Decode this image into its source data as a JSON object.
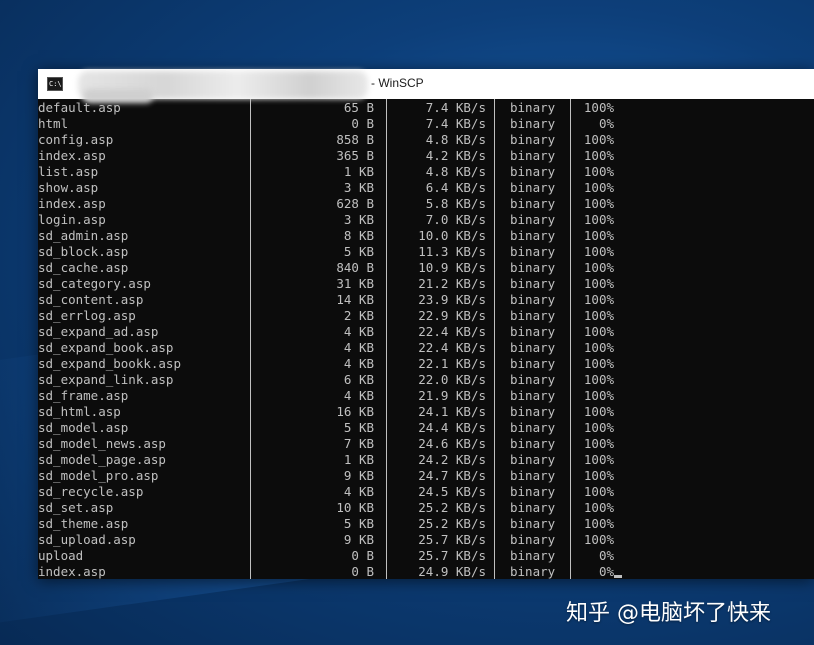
{
  "window": {
    "title": "- WinSCP",
    "icon": "console-icon"
  },
  "transfers": [
    {
      "name": "default.asp",
      "size": "65 B",
      "speed": "7.4 KB/s",
      "mode": "binary",
      "progress": "100%"
    },
    {
      "name": "html",
      "size": "0 B",
      "speed": "7.4 KB/s",
      "mode": "binary",
      "progress": "0%"
    },
    {
      "name": "config.asp",
      "size": "858 B",
      "speed": "4.8 KB/s",
      "mode": "binary",
      "progress": "100%"
    },
    {
      "name": "index.asp",
      "size": "365 B",
      "speed": "4.2 KB/s",
      "mode": "binary",
      "progress": "100%"
    },
    {
      "name": "list.asp",
      "size": "1 KB",
      "speed": "4.8 KB/s",
      "mode": "binary",
      "progress": "100%"
    },
    {
      "name": "show.asp",
      "size": "3 KB",
      "speed": "6.4 KB/s",
      "mode": "binary",
      "progress": "100%"
    },
    {
      "name": "index.asp",
      "size": "628 B",
      "speed": "5.8 KB/s",
      "mode": "binary",
      "progress": "100%"
    },
    {
      "name": "login.asp",
      "size": "3 KB",
      "speed": "7.0 KB/s",
      "mode": "binary",
      "progress": "100%"
    },
    {
      "name": "sd_admin.asp",
      "size": "8 KB",
      "speed": "10.0 KB/s",
      "mode": "binary",
      "progress": "100%"
    },
    {
      "name": "sd_block.asp",
      "size": "5 KB",
      "speed": "11.3 KB/s",
      "mode": "binary",
      "progress": "100%"
    },
    {
      "name": "sd_cache.asp",
      "size": "840 B",
      "speed": "10.9 KB/s",
      "mode": "binary",
      "progress": "100%"
    },
    {
      "name": "sd_category.asp",
      "size": "31 KB",
      "speed": "21.2 KB/s",
      "mode": "binary",
      "progress": "100%"
    },
    {
      "name": "sd_content.asp",
      "size": "14 KB",
      "speed": "23.9 KB/s",
      "mode": "binary",
      "progress": "100%"
    },
    {
      "name": "sd_errlog.asp",
      "size": "2 KB",
      "speed": "22.9 KB/s",
      "mode": "binary",
      "progress": "100%"
    },
    {
      "name": "sd_expand_ad.asp",
      "size": "4 KB",
      "speed": "22.4 KB/s",
      "mode": "binary",
      "progress": "100%"
    },
    {
      "name": "sd_expand_book.asp",
      "size": "4 KB",
      "speed": "22.4 KB/s",
      "mode": "binary",
      "progress": "100%"
    },
    {
      "name": "sd_expand_bookk.asp",
      "size": "4 KB",
      "speed": "22.1 KB/s",
      "mode": "binary",
      "progress": "100%"
    },
    {
      "name": "sd_expand_link.asp",
      "size": "6 KB",
      "speed": "22.0 KB/s",
      "mode": "binary",
      "progress": "100%"
    },
    {
      "name": "sd_frame.asp",
      "size": "4 KB",
      "speed": "21.9 KB/s",
      "mode": "binary",
      "progress": "100%"
    },
    {
      "name": "sd_html.asp",
      "size": "16 KB",
      "speed": "24.1 KB/s",
      "mode": "binary",
      "progress": "100%"
    },
    {
      "name": "sd_model.asp",
      "size": "5 KB",
      "speed": "24.4 KB/s",
      "mode": "binary",
      "progress": "100%"
    },
    {
      "name": "sd_model_news.asp",
      "size": "7 KB",
      "speed": "24.6 KB/s",
      "mode": "binary",
      "progress": "100%"
    },
    {
      "name": "sd_model_page.asp",
      "size": "1 KB",
      "speed": "24.2 KB/s",
      "mode": "binary",
      "progress": "100%"
    },
    {
      "name": "sd_model_pro.asp",
      "size": "9 KB",
      "speed": "24.7 KB/s",
      "mode": "binary",
      "progress": "100%"
    },
    {
      "name": "sd_recycle.asp",
      "size": "4 KB",
      "speed": "24.5 KB/s",
      "mode": "binary",
      "progress": "100%"
    },
    {
      "name": "sd_set.asp",
      "size": "10 KB",
      "speed": "25.2 KB/s",
      "mode": "binary",
      "progress": "100%"
    },
    {
      "name": "sd_theme.asp",
      "size": "5 KB",
      "speed": "25.2 KB/s",
      "mode": "binary",
      "progress": "100%"
    },
    {
      "name": "sd_upload.asp",
      "size": "9 KB",
      "speed": "25.7 KB/s",
      "mode": "binary",
      "progress": "100%"
    },
    {
      "name": "upload",
      "size": "0 B",
      "speed": "25.7 KB/s",
      "mode": "binary",
      "progress": "0%"
    },
    {
      "name": "index.asp",
      "size": "0 B",
      "speed": "24.9 KB/s",
      "mode": "binary",
      "progress": "0%"
    }
  ],
  "watermark": "知乎 @电脑坏了快来"
}
